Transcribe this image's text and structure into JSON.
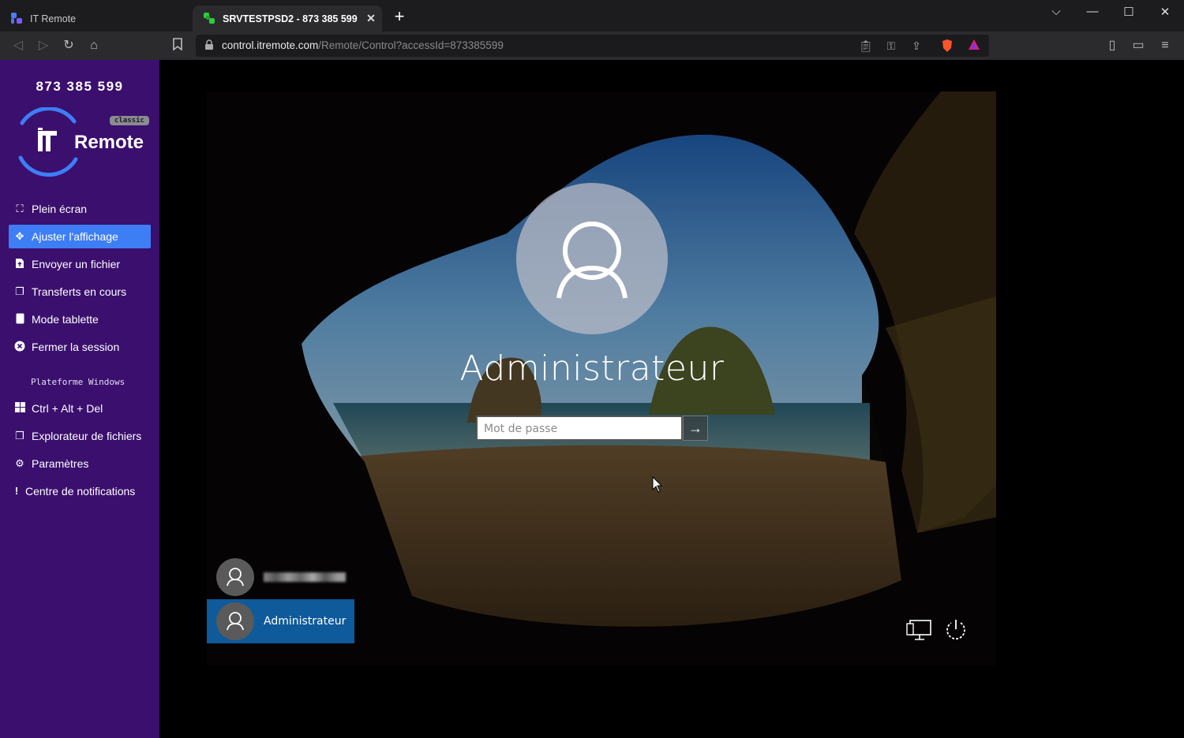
{
  "browser": {
    "tabs": [
      {
        "title": "IT Remote",
        "active": false
      },
      {
        "title": "SRVTESTPSD2 - 873 385 599",
        "active": true
      }
    ],
    "url_host": "control.itremote.com",
    "url_path": "/Remote/Control?accessId=873385599"
  },
  "sidebar": {
    "access_id": "873 385 599",
    "logo_text": "Remote",
    "logo_badge": "classic",
    "menu": [
      {
        "label": "Plein écran",
        "icon": "fullscreen-icon",
        "active": false
      },
      {
        "label": "Ajuster l'affichage",
        "icon": "fit-display-icon",
        "active": true
      },
      {
        "label": "Envoyer un fichier",
        "icon": "file-upload-icon",
        "active": false
      },
      {
        "label": "Transferts en cours",
        "icon": "transfers-icon",
        "active": false
      },
      {
        "label": "Mode tablette",
        "icon": "tablet-icon",
        "active": false
      },
      {
        "label": "Fermer la session",
        "icon": "close-session-icon",
        "active": false
      }
    ],
    "section_title": "Plateforme Windows",
    "windows_menu": [
      {
        "label": "Ctrl + Alt + Del",
        "icon": "windows-icon"
      },
      {
        "label": "Explorateur de fichiers",
        "icon": "file-explorer-icon"
      },
      {
        "label": "Paramètres",
        "icon": "settings-icon"
      },
      {
        "label": "Centre de notifications",
        "icon": "notification-icon"
      }
    ],
    "accent_color": "#3d7ef5",
    "background_color": "#3b0f6e"
  },
  "remote": {
    "username": "Administrateur",
    "password_placeholder": "Mot de passe",
    "users": [
      {
        "name": "",
        "selected": false,
        "blurred": true
      },
      {
        "name": "Administrateur",
        "selected": true
      }
    ],
    "selected_color": "#0f5a9a"
  }
}
